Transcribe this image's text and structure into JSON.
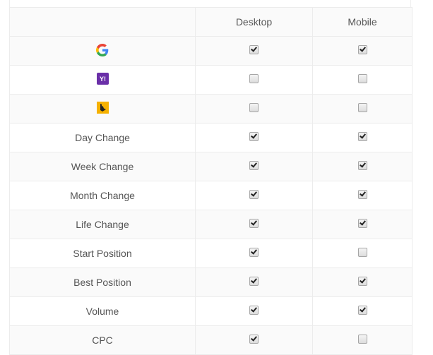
{
  "header": {
    "col_label": "",
    "col_desktop": "Desktop",
    "col_mobile": "Mobile"
  },
  "rows": [
    {
      "type": "icon",
      "icon": "google-icon",
      "label": "Google",
      "desktop": true,
      "mobile": true
    },
    {
      "type": "icon",
      "icon": "yahoo-icon",
      "label": "Yahoo",
      "desktop": false,
      "mobile": false
    },
    {
      "type": "icon",
      "icon": "bing-icon",
      "label": "Bing",
      "desktop": false,
      "mobile": false
    },
    {
      "type": "text",
      "label": "Day Change",
      "desktop": true,
      "mobile": true
    },
    {
      "type": "text",
      "label": "Week Change",
      "desktop": true,
      "mobile": true
    },
    {
      "type": "text",
      "label": "Month Change",
      "desktop": true,
      "mobile": true
    },
    {
      "type": "text",
      "label": "Life Change",
      "desktop": true,
      "mobile": true
    },
    {
      "type": "text",
      "label": "Start Position",
      "desktop": true,
      "mobile": false
    },
    {
      "type": "text",
      "label": "Best Position",
      "desktop": true,
      "mobile": true
    },
    {
      "type": "text",
      "label": "Volume",
      "desktop": true,
      "mobile": true
    },
    {
      "type": "text",
      "label": "CPC",
      "desktop": true,
      "mobile": false
    }
  ]
}
